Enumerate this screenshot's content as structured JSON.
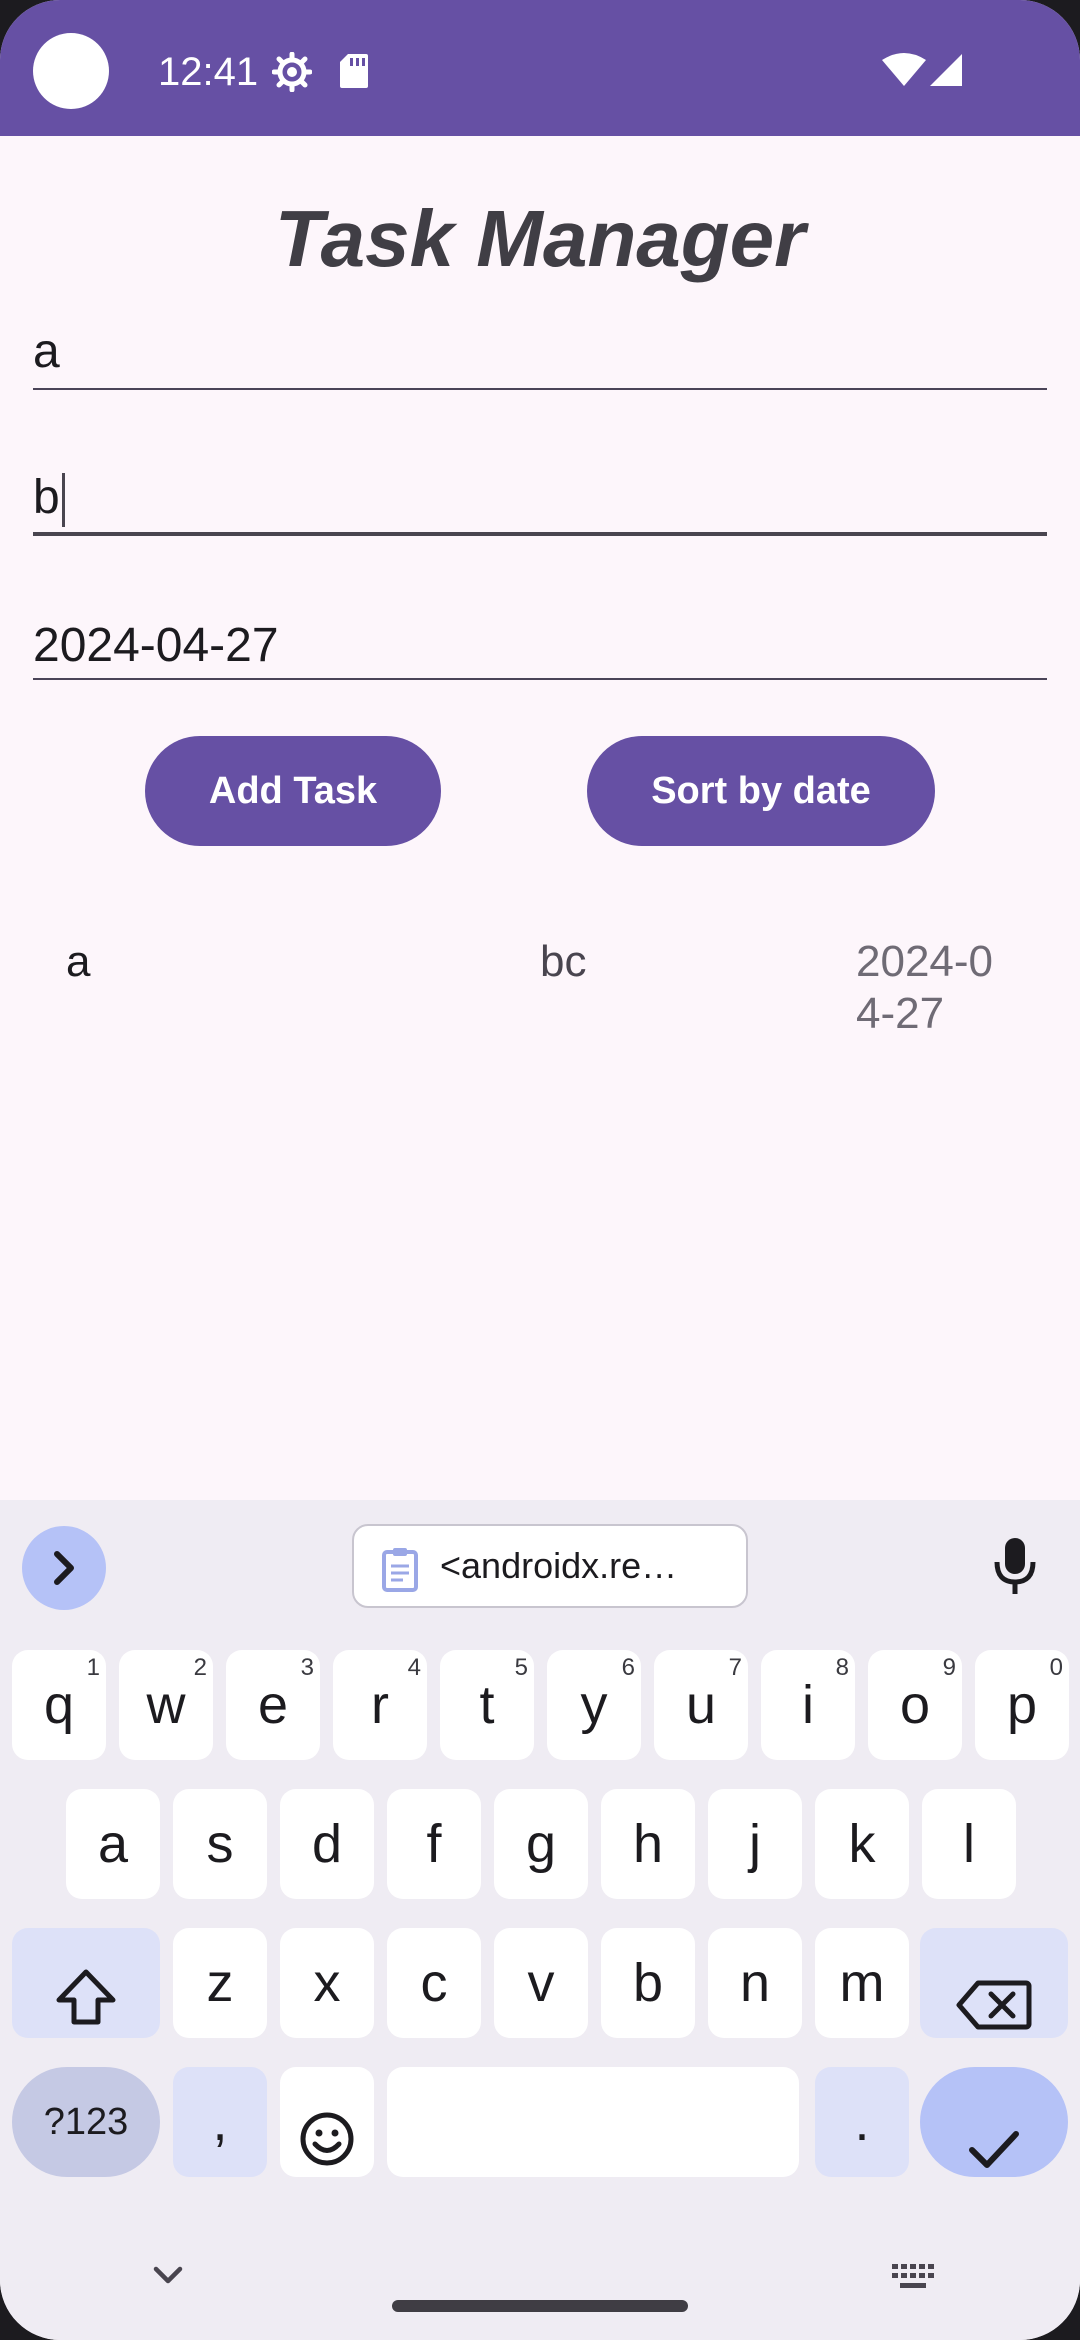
{
  "status_bar": {
    "time": "12:41",
    "icons": [
      "settings-gear-icon",
      "sd-card-icon",
      "wifi-icon",
      "signal-icon"
    ],
    "color": "#6650a4"
  },
  "app": {
    "title": "Task Manager",
    "fields": {
      "task_name": "a",
      "task_description": "b",
      "due_date": "2024-04-27"
    },
    "buttons": {
      "add_task": "Add Task",
      "sort_by_date": "Sort by date"
    },
    "tasks": [
      {
        "name": "a",
        "description": "bc",
        "date": "2024-04-27",
        "date_line1": "2024-0",
        "date_line2": "4-27"
      }
    ]
  },
  "keyboard": {
    "expand_icon": "chevron-right-icon",
    "clipboard_suggestion": "<androidx.re…",
    "mic_icon": "mic-icon",
    "rows": [
      [
        {
          "label": "q",
          "hint": "1"
        },
        {
          "label": "w",
          "hint": "2"
        },
        {
          "label": "e",
          "hint": "3"
        },
        {
          "label": "r",
          "hint": "4"
        },
        {
          "label": "t",
          "hint": "5"
        },
        {
          "label": "y",
          "hint": "6"
        },
        {
          "label": "u",
          "hint": "7"
        },
        {
          "label": "i",
          "hint": "8"
        },
        {
          "label": "o",
          "hint": "9"
        },
        {
          "label": "p",
          "hint": "0"
        }
      ],
      [
        {
          "label": "a"
        },
        {
          "label": "s"
        },
        {
          "label": "d"
        },
        {
          "label": "f"
        },
        {
          "label": "g"
        },
        {
          "label": "h"
        },
        {
          "label": "j"
        },
        {
          "label": "k"
        },
        {
          "label": "l"
        }
      ],
      [
        {
          "label": "z"
        },
        {
          "label": "x"
        },
        {
          "label": "c"
        },
        {
          "label": "v"
        },
        {
          "label": "b"
        },
        {
          "label": "n"
        },
        {
          "label": "m"
        }
      ]
    ],
    "symbols_label": "?123",
    "comma_label": ",",
    "period_label": ".",
    "accent_color": "#b5c2f7"
  }
}
